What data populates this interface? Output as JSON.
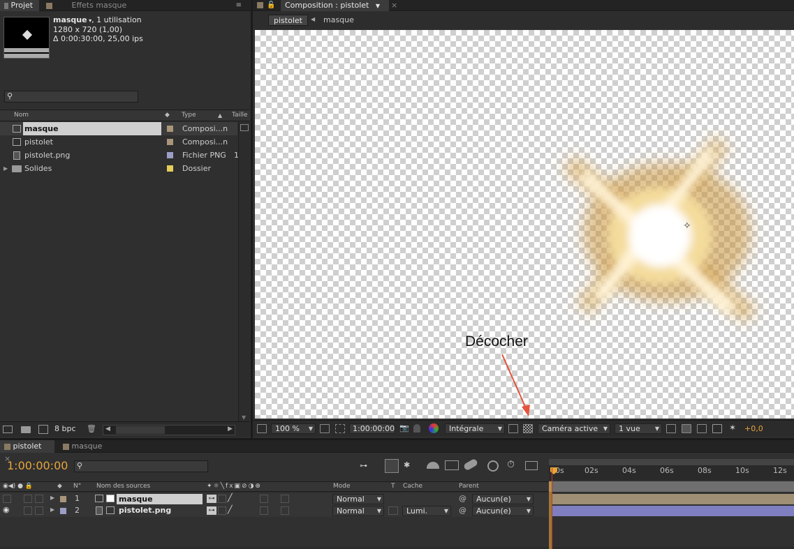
{
  "project": {
    "tab_label": "Projet",
    "tab2_label": "Effets masque",
    "item_name": "masque",
    "item_usage": ", 1 utilisation",
    "item_dims": "1280 x 720 (1,00)",
    "item_duration": "Δ 0:00:30:00, 25,00 ips",
    "search_placeholder": "",
    "col_name": "Nom",
    "col_type": "Type",
    "col_size": "Taille",
    "items": [
      {
        "name": "masque",
        "type": "Composi...n",
        "color": "#a8957a",
        "size": ""
      },
      {
        "name": "pistolet",
        "type": "Composi...n",
        "color": "#a8957a",
        "size": ""
      },
      {
        "name": "pistolet.png",
        "type": "Fichier PNG",
        "color": "#9c9ec8",
        "size": "1"
      },
      {
        "name": "Solides",
        "type": "Dossier",
        "color": "#e5cd5a",
        "size": ""
      }
    ],
    "bpc": "8 bpc"
  },
  "comp": {
    "tab_label": "Composition : pistolet",
    "breadcrumb_active": "pistolet",
    "breadcrumb_next": "masque",
    "annotation": "Décocher",
    "zoom": "100 %",
    "timecode": "1:00:00:00",
    "resolution": "Intégrale",
    "camera": "Caméra active",
    "views": "1 vue",
    "exposure": "+0,0"
  },
  "timeline": {
    "tab1": "pistolet",
    "tab2": "masque",
    "timecode": "1:00:00:00",
    "col_num": "N°",
    "col_source": "Nom des sources",
    "col_mode": "Mode",
    "col_t": "T",
    "col_cache": "Cache",
    "col_parent": "Parent",
    "ruler": [
      "0s",
      "02s",
      "04s",
      "06s",
      "08s",
      "10s",
      "12s"
    ],
    "layers": [
      {
        "num": "1",
        "name": "masque",
        "mode": "Normal",
        "cache": "",
        "parent": "Aucun(e)",
        "color": "#a8957a"
      },
      {
        "num": "2",
        "name": "pistolet.png",
        "mode": "Normal",
        "cache": "Lumi.",
        "parent": "Aucun(e)",
        "color": "#9c9ec8"
      }
    ]
  },
  "colors": {
    "accent_orange": "#e8a53a",
    "arrow_red": "#e5533d",
    "layer1_bar": "#9f8f74",
    "layer2_bar": "#7e7ec0"
  }
}
